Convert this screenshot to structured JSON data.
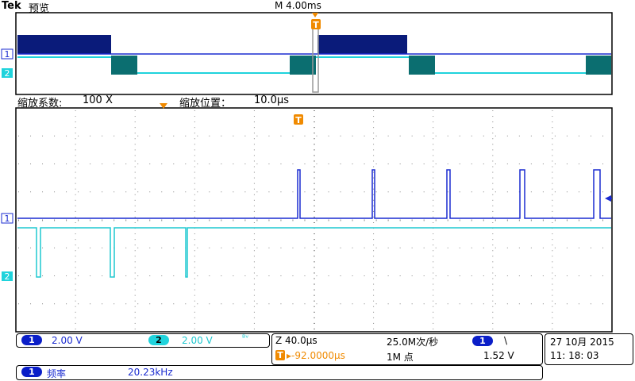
{
  "header": {
    "brand": "Tek",
    "mode": "预览",
    "timebase": "M 4.00ms",
    "trigger_marker": "T"
  },
  "zoom": {
    "factor_label": "缩放系数:",
    "factor_value": "100 X",
    "position_label": "缩放位置：",
    "position_value": "10.0µs"
  },
  "channels": {
    "ch1_marker": "1",
    "ch2_marker": "2",
    "ch1_color": "#0a1ec8",
    "ch2_color": "#1fd3dc",
    "ch2_dark_color": "#0b6e70"
  },
  "status": {
    "ch1_label": "1",
    "ch1_scale": "2.00 V",
    "ch2_label": "2",
    "ch2_scale": "2.00 V",
    "bw_icon": "bandwidth-limit-icon",
    "zoom_time": "Z 40.0µs",
    "sample_rate": "25.0M次/秒",
    "trigger_source": "1",
    "trigger_slope": "\\",
    "trigger_position": "▸-92.0000µs",
    "record_length": "1M 点",
    "trigger_level": "1.52 V",
    "date": "27 10月  2015",
    "time": "11: 18: 03"
  },
  "measurement": {
    "channel": "1",
    "name": "频率",
    "value": "20.23kHz"
  }
}
